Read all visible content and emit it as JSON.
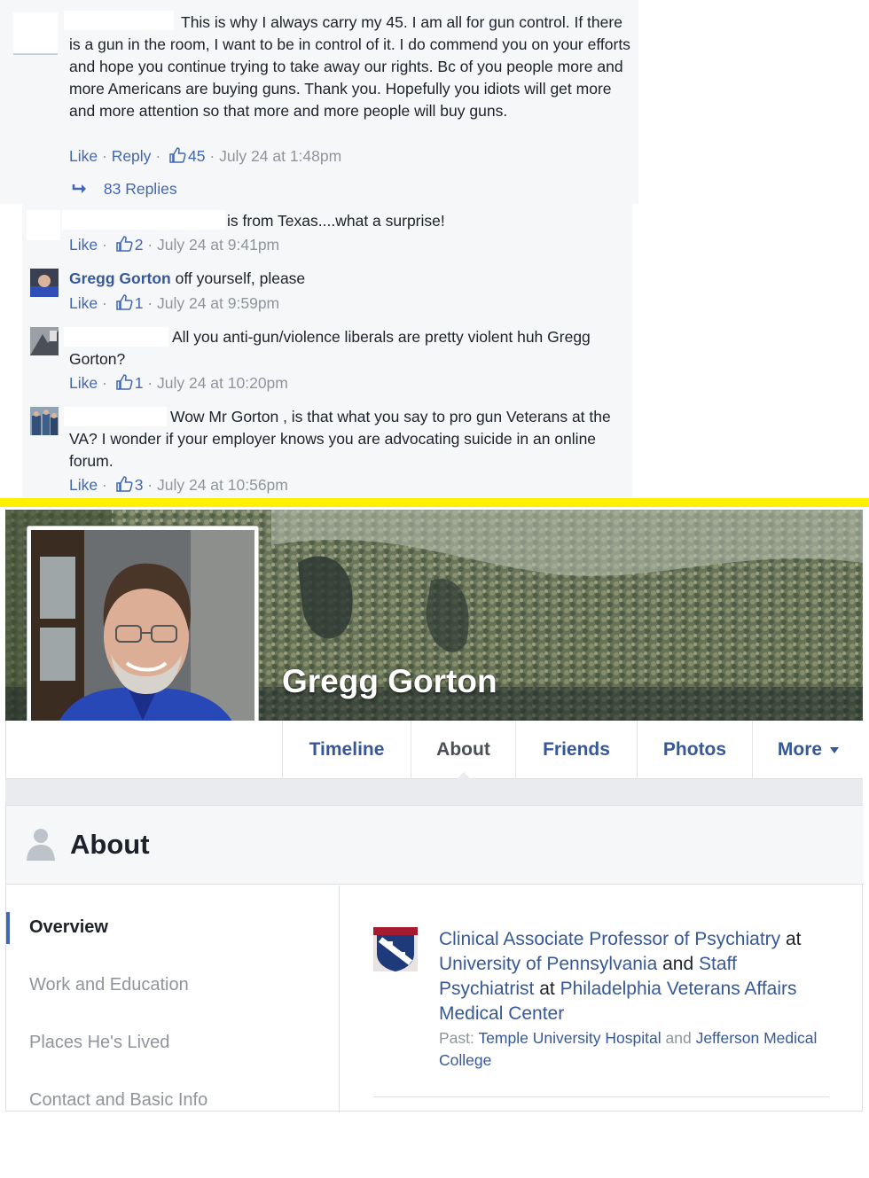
{
  "thread": {
    "top_comment": {
      "text": "This is why I always carry my 45. I am all for gun control. If there is a gun in the room, I want to be in control of it. I do commend you on your efforts and hope you continue trying to take away our rights. Bc of you people more and more Americans are buying guns. Thank you. Hopefully you idiots will get more and more attention so that more and more people will buy guns.",
      "like_label": "Like",
      "reply_label": "Reply",
      "likes": "45",
      "time": "July 24 at 1:48pm",
      "replies_label": "83 Replies"
    },
    "replies": [
      {
        "author": "",
        "text": "is from Texas....what a surprise!",
        "like_label": "Like",
        "likes": "2",
        "time": "July 24 at 9:41pm"
      },
      {
        "author": "Gregg Gorton",
        "text": "off yourself, please",
        "like_label": "Like",
        "likes": "1",
        "time": "July 24 at 9:59pm"
      },
      {
        "author": "",
        "text": "All you anti-gun/violence liberals are pretty violent huh Gregg Gorton?",
        "like_label": "Like",
        "likes": "1",
        "time": "July 24 at 10:20pm"
      },
      {
        "author": "",
        "text": "Wow Mr Gorton , is that what you say to pro gun Veterans at the VA? I wonder if your employer knows you are advocating suicide in an online forum.",
        "like_label": "Like",
        "likes": "3",
        "time": "July 24 at 10:56pm"
      }
    ],
    "separator": "·"
  },
  "profile": {
    "name": "Gregg Gorton",
    "tabs": [
      "Timeline",
      "About",
      "Friends",
      "Photos",
      "More"
    ],
    "active_tab": "About"
  },
  "about": {
    "title": "About",
    "sidebar": [
      "Overview",
      "Work and Education",
      "Places He's Lived",
      "Contact and Basic Info"
    ],
    "active_item": "Overview",
    "work": {
      "role1": "Clinical Associate Professor of Psychiatry",
      "at1": "at",
      "org1": "University of Pennsylvania",
      "and": "and",
      "role2": "Staff Psychiatrist",
      "at2": "at",
      "org2": "Philadelphia Veterans Affairs Medical Center",
      "past_label": "Past:",
      "past1": "Temple University Hospital",
      "past_and": "and",
      "past2": "Jefferson Medical College"
    }
  },
  "colors": {
    "link": "#365899",
    "meta": "#90949c",
    "divider_line": "#ffef00",
    "panel_bg": "#f6f7f9"
  },
  "icons": [
    "thumbs-up-icon",
    "reply-arrow-icon",
    "person-icon",
    "caret-down-icon",
    "university-shield-icon"
  ]
}
